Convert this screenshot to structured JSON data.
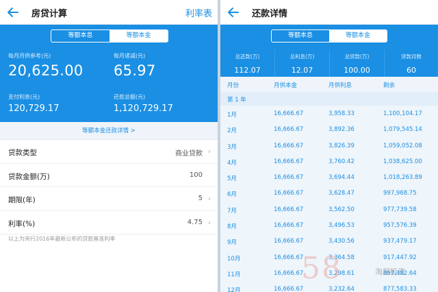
{
  "left": {
    "header": {
      "title": "房贷计算",
      "action": "利率表"
    },
    "tabs": [
      "等额本息",
      "等额本金"
    ],
    "active_tab": 1,
    "stats": {
      "monthly_label": "每月月供参考(元)",
      "monthly_value": "20,625.00",
      "decrease_label": "每月递减(元)",
      "decrease_value": "65.97",
      "interest_label": "支付利息(元)",
      "interest_value": "120,729.17",
      "total_label": "还款总额(元)",
      "total_value": "1,120,729.17"
    },
    "detail_link": "等额本金还款详情 >",
    "form": [
      {
        "label": "贷款类型",
        "value": "商业贷款",
        "chevron": true
      },
      {
        "label": "贷款金额(万)",
        "value": "100",
        "chevron": false
      },
      {
        "label": "期限(年)",
        "value": "5",
        "chevron": true
      },
      {
        "label": "利率(%)",
        "value": "4.75",
        "chevron": true
      }
    ],
    "note": "以上为央行2016年最新公布的贷款基准利率"
  },
  "right": {
    "header": {
      "title": "还款详情"
    },
    "tabs": [
      "等额本息",
      "等额本金"
    ],
    "active_tab": 1,
    "summary": [
      {
        "label": "总还款(万)",
        "value": "112.07"
      },
      {
        "label": "总利息(万)",
        "value": "12.07"
      },
      {
        "label": "总贷款(万)",
        "value": "100.00"
      },
      {
        "label": "贷款月数",
        "value": "60"
      }
    ],
    "columns": [
      "月份",
      "月供本金",
      "月供利息",
      "剩余"
    ],
    "year_label": "第 1 年",
    "rows": [
      [
        "1月",
        "16,666.67",
        "3,958.33",
        "1,100,104.17"
      ],
      [
        "2月",
        "16,666.67",
        "3,892.36",
        "1,079,545.14"
      ],
      [
        "3月",
        "16,666.67",
        "3,826.39",
        "1,059,052.08"
      ],
      [
        "4月",
        "16,666.67",
        "3,760.42",
        "1,038,625.00"
      ],
      [
        "5月",
        "16,666.67",
        "3,694.44",
        "1,018,263.89"
      ],
      [
        "6月",
        "16,666.67",
        "3,628.47",
        "997,968.75"
      ],
      [
        "7月",
        "16,666.67",
        "3,562.50",
        "977,739.58"
      ],
      [
        "8月",
        "16,666.67",
        "3,496.53",
        "957,576.39"
      ],
      [
        "9月",
        "16,666.67",
        "3,430.56",
        "937,479.17"
      ],
      [
        "10月",
        "16,666.67",
        "3,364.58",
        "917,447.92"
      ],
      [
        "11月",
        "16,666.67",
        "3,298.61",
        "897,482.64"
      ],
      [
        "12月",
        "16,666.67",
        "3,232.64",
        "877,583.33"
      ]
    ]
  },
  "watermark": {
    "mark": "58",
    "text": "淘屋投资"
  },
  "colors": {
    "accent": "#1a8fe3",
    "text": "#222222",
    "muted": "#999999",
    "row_bg": "#eef5fb"
  }
}
